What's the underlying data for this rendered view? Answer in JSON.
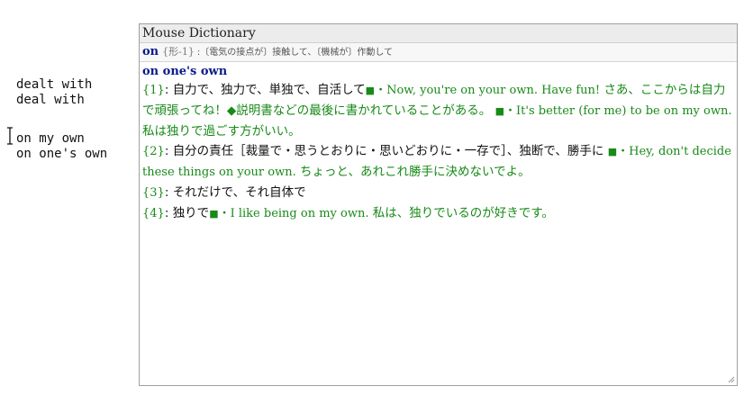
{
  "left_panel": {
    "lines": [
      "dealt with",
      "deal with",
      "on my own",
      "on one's own"
    ]
  },
  "dictionary": {
    "title": "Mouse Dictionary",
    "headword": {
      "word": "on",
      "tag": "{形-1}",
      "gloss": ":〔電気の接点が〕接触して、〔機械が〕作動して"
    },
    "entry": {
      "head": "on one's own",
      "senses": [
        {
          "num": "{1}",
          "def": "自力で、独力で、単独で、自活して",
          "ex_en": "・Now, you're on your own. Have fun!",
          "ex_ja": "さあ、ここからは自力で頑張ってね！",
          "note": "◆説明書などの最後に書かれていることがある。",
          "ex2_en": "・It's better (for me) to be on my own.",
          "ex2_ja": "私は独りで過ごす方がいい。"
        },
        {
          "num": "{2}",
          "def": "自分の責任［裁量で・思うとおりに・思いどおりに・一存で］、独断で、勝手に",
          "ex_en": "・Hey, don't decide these things on your own.",
          "ex_ja": "ちょっと、あれこれ勝手に決めないでよ。"
        },
        {
          "num": "{3}",
          "def": "それだけで、それ自体で"
        },
        {
          "num": "{4}",
          "def": "独りで",
          "ex_en": "・I like being on my own.",
          "ex_ja": "私は、独りでいるのが好きです。"
        }
      ]
    }
  },
  "icons": {
    "cursor": "text-cursor-icon",
    "example_marker": "square-bullet-icon",
    "resize": "resize-grip-icon"
  },
  "colors": {
    "headword": "#0a1b8a",
    "example": "#188a18",
    "title_bar": "#ececec",
    "border": "#a0a0a0"
  }
}
